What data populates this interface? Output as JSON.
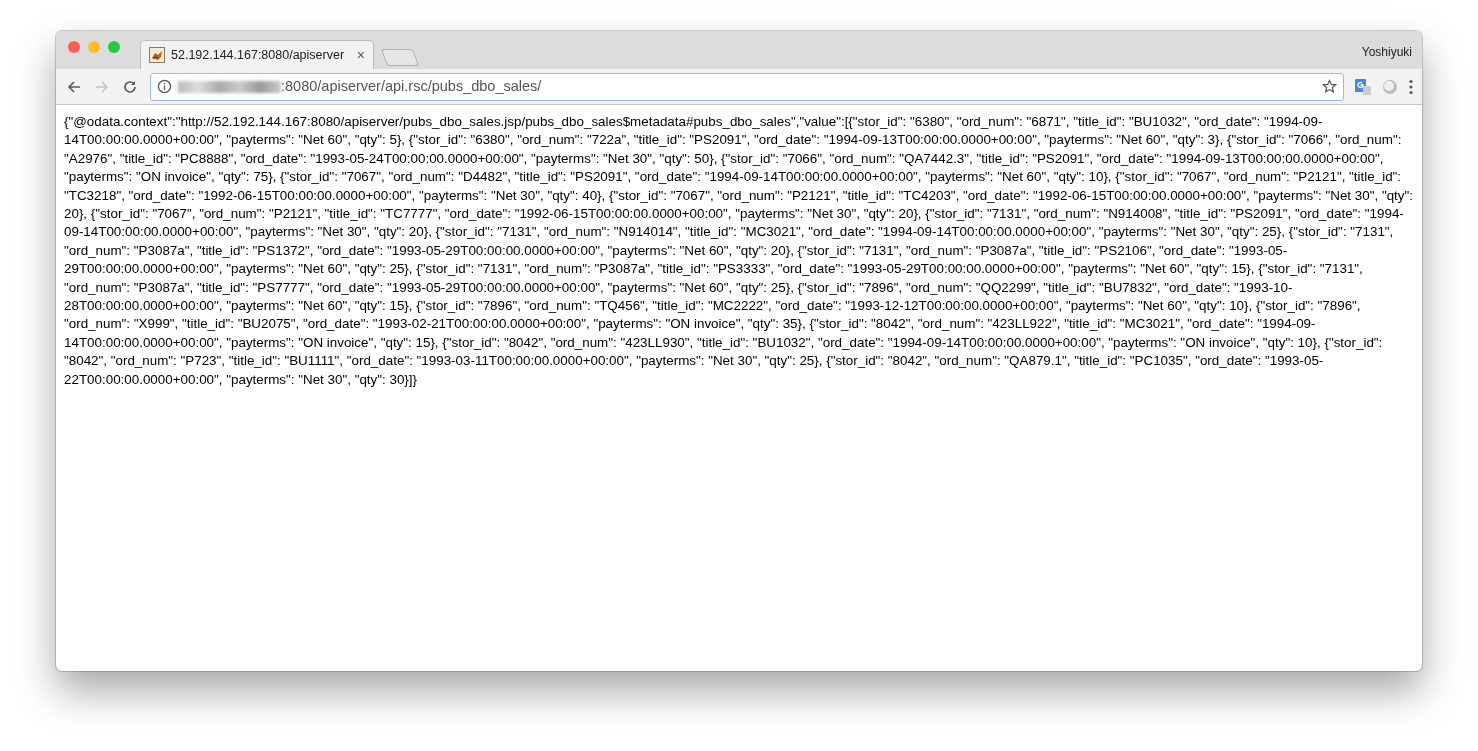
{
  "window": {
    "profile": "Yoshiyuki"
  },
  "tabs": [
    {
      "title": "52.192.144.167:8080/apiserver",
      "close": "×",
      "selected": true
    }
  ],
  "nav_buttons": [
    {
      "kind": "back",
      "disabled": false
    },
    {
      "kind": "forward",
      "disabled": true
    },
    {
      "kind": "reload",
      "disabled": false
    }
  ],
  "address_bar": {
    "url": ":8080/apiserver/api.rsc/pubs_dbo_sales/"
  },
  "body": {
    "text": "{\"@odata.context\":\"http://52.192.144.167:8080/apiserver/pubs_dbo_sales.jsp/pubs_dbo_sales$metadata#pubs_dbo_sales\",\"value\":[{\"stor_id\": \"6380\", \"ord_num\": \"6871\", \"title_id\": \"BU1032\", \"ord_date\": \"1994-09-14T00:00:00.0000+00:00\", \"payterms\": \"Net 60\", \"qty\": 5}, {\"stor_id\": \"6380\", \"ord_num\": \"722a\", \"title_id\": \"PS2091\", \"ord_date\": \"1994-09-13T00:00:00.0000+00:00\", \"payterms\": \"Net 60\", \"qty\": 3}, {\"stor_id\": \"7066\", \"ord_num\": \"A2976\", \"title_id\": \"PC8888\", \"ord_date\": \"1993-05-24T00:00:00.0000+00:00\", \"payterms\": \"Net 30\", \"qty\": 50}, {\"stor_id\": \"7066\", \"ord_num\": \"QA7442.3\", \"title_id\": \"PS2091\", \"ord_date\": \"1994-09-13T00:00:00.0000+00:00\", \"payterms\": \"ON invoice\", \"qty\": 75}, {\"stor_id\": \"7067\", \"ord_num\": \"D4482\", \"title_id\": \"PS2091\", \"ord_date\": \"1994-09-14T00:00:00.0000+00:00\", \"payterms\": \"Net 60\", \"qty\": 10}, {\"stor_id\": \"7067\", \"ord_num\": \"P2121\", \"title_id\": \"TC3218\", \"ord_date\": \"1992-06-15T00:00:00.0000+00:00\", \"payterms\": \"Net 30\", \"qty\": 40}, {\"stor_id\": \"7067\", \"ord_num\": \"P2121\", \"title_id\": \"TC4203\", \"ord_date\": \"1992-06-15T00:00:00.0000+00:00\", \"payterms\": \"Net 30\", \"qty\": 20}, {\"stor_id\": \"7067\", \"ord_num\": \"P2121\", \"title_id\": \"TC7777\", \"ord_date\": \"1992-06-15T00:00:00.0000+00:00\", \"payterms\": \"Net 30\", \"qty\": 20}, {\"stor_id\": \"7131\", \"ord_num\": \"N914008\", \"title_id\": \"PS2091\", \"ord_date\": \"1994-09-14T00:00:00.0000+00:00\", \"payterms\": \"Net 30\", \"qty\": 20}, {\"stor_id\": \"7131\", \"ord_num\": \"N914014\", \"title_id\": \"MC3021\", \"ord_date\": \"1994-09-14T00:00:00.0000+00:00\", \"payterms\": \"Net 30\", \"qty\": 25}, {\"stor_id\": \"7131\", \"ord_num\": \"P3087a\", \"title_id\": \"PS1372\", \"ord_date\": \"1993-05-29T00:00:00.0000+00:00\", \"payterms\": \"Net 60\", \"qty\": 20}, {\"stor_id\": \"7131\", \"ord_num\": \"P3087a\", \"title_id\": \"PS2106\", \"ord_date\": \"1993-05-29T00:00:00.0000+00:00\", \"payterms\": \"Net 60\", \"qty\": 25}, {\"stor_id\": \"7131\", \"ord_num\": \"P3087a\", \"title_id\": \"PS3333\", \"ord_date\": \"1993-05-29T00:00:00.0000+00:00\", \"payterms\": \"Net 60\", \"qty\": 15}, {\"stor_id\": \"7131\", \"ord_num\": \"P3087a\", \"title_id\": \"PS7777\", \"ord_date\": \"1993-05-29T00:00:00.0000+00:00\", \"payterms\": \"Net 60\", \"qty\": 25}, {\"stor_id\": \"7896\", \"ord_num\": \"QQ2299\", \"title_id\": \"BU7832\", \"ord_date\": \"1993-10-28T00:00:00.0000+00:00\", \"payterms\": \"Net 60\", \"qty\": 15}, {\"stor_id\": \"7896\", \"ord_num\": \"TQ456\", \"title_id\": \"MC2222\", \"ord_date\": \"1993-12-12T00:00:00.0000+00:00\", \"payterms\": \"Net 60\", \"qty\": 10}, {\"stor_id\": \"7896\", \"ord_num\": \"X999\", \"title_id\": \"BU2075\", \"ord_date\": \"1993-02-21T00:00:00.0000+00:00\", \"payterms\": \"ON invoice\", \"qty\": 35}, {\"stor_id\": \"8042\", \"ord_num\": \"423LL922\", \"title_id\": \"MC3021\", \"ord_date\": \"1994-09-14T00:00:00.0000+00:00\", \"payterms\": \"ON invoice\", \"qty\": 15}, {\"stor_id\": \"8042\", \"ord_num\": \"423LL930\", \"title_id\": \"BU1032\", \"ord_date\": \"1994-09-14T00:00:00.0000+00:00\", \"payterms\": \"ON invoice\", \"qty\": 10}, {\"stor_id\": \"8042\", \"ord_num\": \"P723\", \"title_id\": \"BU1111\", \"ord_date\": \"1993-03-11T00:00:00.0000+00:00\", \"payterms\": \"Net 30\", \"qty\": 25}, {\"stor_id\": \"8042\", \"ord_num\": \"QA879.1\", \"title_id\": \"PC1035\", \"ord_date\": \"1993-05-22T00:00:00.0000+00:00\", \"payterms\": \"Net 30\", \"qty\": 30}]}"
  }
}
